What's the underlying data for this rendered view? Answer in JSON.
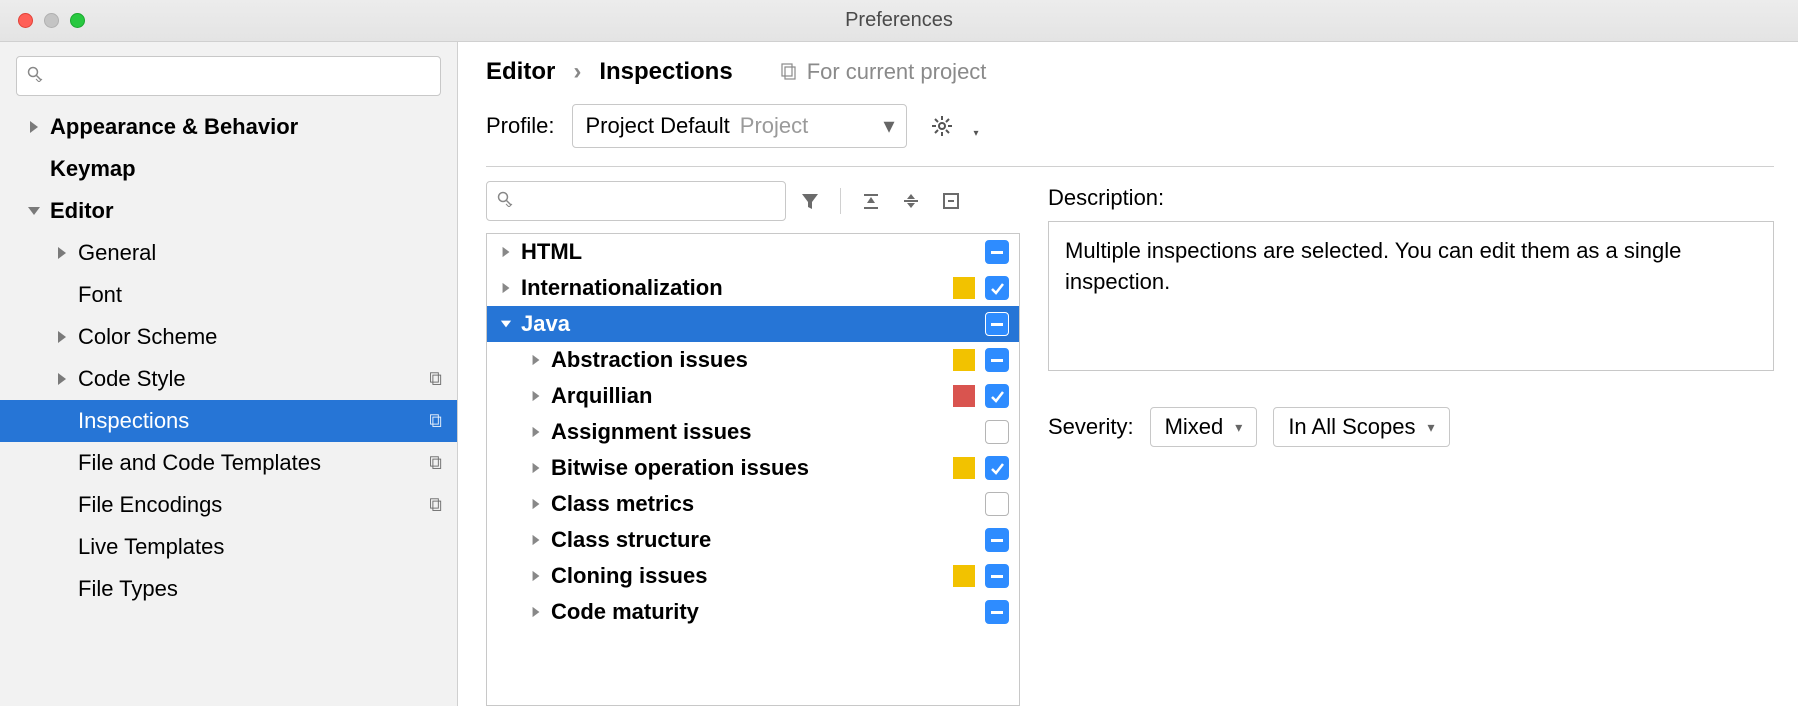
{
  "window": {
    "title": "Preferences"
  },
  "sidebar": {
    "search_placeholder": "",
    "items": [
      {
        "label": "Appearance & Behavior",
        "bold": true,
        "indent": 0,
        "arrow": "right"
      },
      {
        "label": "Keymap",
        "bold": true,
        "indent": 0,
        "arrow": "none"
      },
      {
        "label": "Editor",
        "bold": true,
        "indent": 0,
        "arrow": "down"
      },
      {
        "label": "General",
        "bold": false,
        "indent": 1,
        "arrow": "right"
      },
      {
        "label": "Font",
        "bold": false,
        "indent": 1,
        "arrow": "none"
      },
      {
        "label": "Color Scheme",
        "bold": false,
        "indent": 1,
        "arrow": "right"
      },
      {
        "label": "Code Style",
        "bold": false,
        "indent": 1,
        "arrow": "right",
        "project": true
      },
      {
        "label": "Inspections",
        "bold": false,
        "indent": 1,
        "arrow": "none",
        "project": true,
        "selected": true
      },
      {
        "label": "File and Code Templates",
        "bold": false,
        "indent": 1,
        "arrow": "none",
        "project": true
      },
      {
        "label": "File Encodings",
        "bold": false,
        "indent": 1,
        "arrow": "none",
        "project": true
      },
      {
        "label": "Live Templates",
        "bold": false,
        "indent": 1,
        "arrow": "none"
      },
      {
        "label": "File Types",
        "bold": false,
        "indent": 1,
        "arrow": "none"
      }
    ]
  },
  "breadcrumb": {
    "root": "Editor",
    "leaf": "Inspections",
    "scope_label": "For current project"
  },
  "profile": {
    "label": "Profile:",
    "name": "Project Default",
    "scope": "Project"
  },
  "inspections": {
    "search_placeholder": "",
    "items": [
      {
        "label": "HTML",
        "indent": 0,
        "arrow": "right",
        "sev": null,
        "state": "mixed"
      },
      {
        "label": "Internationalization",
        "indent": 0,
        "arrow": "right",
        "sev": "yellow",
        "state": "checked"
      },
      {
        "label": "Java",
        "indent": 0,
        "arrow": "down",
        "sev": null,
        "state": "mixed",
        "selected": true
      },
      {
        "label": "Abstraction issues",
        "indent": 1,
        "arrow": "right",
        "sev": "yellow",
        "state": "mixed"
      },
      {
        "label": "Arquillian",
        "indent": 1,
        "arrow": "right",
        "sev": "red",
        "state": "checked"
      },
      {
        "label": "Assignment issues",
        "indent": 1,
        "arrow": "right",
        "sev": null,
        "state": "unchecked"
      },
      {
        "label": "Bitwise operation issues",
        "indent": 1,
        "arrow": "right",
        "sev": "yellow",
        "state": "checked"
      },
      {
        "label": "Class metrics",
        "indent": 1,
        "arrow": "right",
        "sev": null,
        "state": "unchecked"
      },
      {
        "label": "Class structure",
        "indent": 1,
        "arrow": "right",
        "sev": null,
        "state": "mixed"
      },
      {
        "label": "Cloning issues",
        "indent": 1,
        "arrow": "right",
        "sev": "yellow",
        "state": "mixed"
      },
      {
        "label": "Code maturity",
        "indent": 1,
        "arrow": "right",
        "sev": null,
        "state": "mixed"
      }
    ]
  },
  "description": {
    "label": "Description:",
    "text": "Multiple inspections are selected. You can edit them as a single inspection."
  },
  "severity": {
    "label": "Severity:",
    "value": "Mixed",
    "scope": "In All Scopes"
  }
}
